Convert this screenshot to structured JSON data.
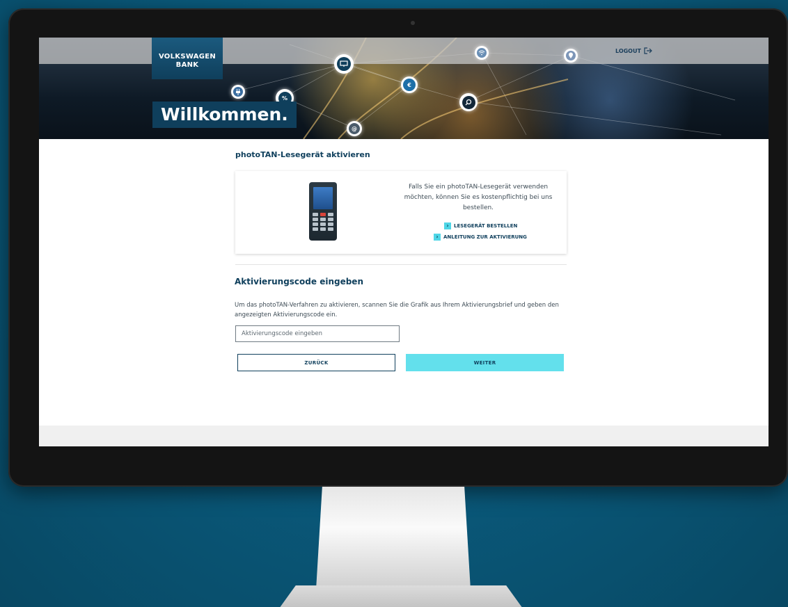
{
  "header": {
    "logo_line1": "VOLKSWAGEN",
    "logo_line2": "BANK",
    "logout_label": "LOGOUT",
    "welcome": "Willkommen."
  },
  "icons": {
    "logout": "logout-arrow-icon",
    "bubbles": [
      "monitor-icon",
      "wifi-icon",
      "location-icon",
      "euro-icon",
      "percent-icon",
      "plug-icon",
      "search-icon",
      "at-icon"
    ],
    "chevron": "chevron-right-icon"
  },
  "photo_tan": {
    "title": "photoTAN-Lesegerät aktivieren",
    "text": "Falls Sie ein photoTAN-Lesegerät verwenden möchten, können Sie es kostenpflichtig bei uns bestellen.",
    "link_order": "LESEGERÄT BESTELLEN",
    "link_guide": "ANLEITUNG ZUR AKTIVIERUNG"
  },
  "activation": {
    "title": "Aktivierungscode eingeben",
    "description": "Um das photoTAN-Verfahren zu aktivieren, scannen Sie die Grafik aus Ihrem Aktivierungsbrief und geben den angezeigten Aktivierungscode ein.",
    "input_placeholder": "Aktivierungscode eingeben",
    "input_value": "",
    "back_label": "ZURÜCK",
    "next_label": "WEITER"
  },
  "colors": {
    "brand_dark": "#0f3f5c",
    "accent_cyan": "#63e0ec",
    "background_blue": "#0a5a7c"
  }
}
